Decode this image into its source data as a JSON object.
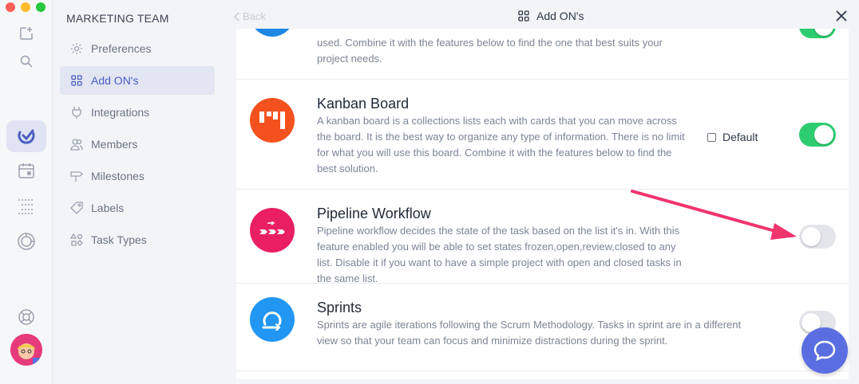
{
  "window": {
    "traffic_colors": [
      "#fe5f57",
      "#febc2e",
      "#28c840"
    ]
  },
  "rail": {
    "icons": [
      "new-task-icon",
      "search-icon",
      "app-logo-icon",
      "calendar-icon",
      "list-icon",
      "reports-icon",
      "help-icon"
    ]
  },
  "nav": {
    "team": "MARKETING TEAM",
    "items": [
      {
        "label": "Preferences",
        "icon": "gear-icon",
        "active": false
      },
      {
        "label": "Add ON's",
        "icon": "grid-icon",
        "active": true
      },
      {
        "label": "Integrations",
        "icon": "plug-icon",
        "active": false
      },
      {
        "label": "Members",
        "icon": "members-icon",
        "active": false
      },
      {
        "label": "Milestones",
        "icon": "signpost-icon",
        "active": false
      },
      {
        "label": "Labels",
        "icon": "tag-icon",
        "active": false
      },
      {
        "label": "Task Types",
        "icon": "shapes-icon",
        "active": false
      }
    ]
  },
  "header": {
    "back": "Back",
    "title": "Add ON's"
  },
  "addons": [
    {
      "title": "",
      "desc": "used. Combine it with the features below to find the one that best suits your project needs.",
      "enabled": true,
      "color": "#1e88e5"
    },
    {
      "title": "Kanban Board",
      "desc": "A kanban board is a collections lists each with cards that you can move across the board. It is the best way to organize any type of information. There is no limit for what you will use this board. Combine it with the features below to find the best solution.",
      "enabled": true,
      "default_label": "Default",
      "color": "#f4511e"
    },
    {
      "title": "Pipeline Workflow",
      "desc": "Pipeline workflow decides the state of the task based on the list it's in. With this feature enabled you will be able to set states frozen,open,review,closed to any list. Disable it if you want to have a simple project with open and closed tasks in the same list.",
      "enabled": false,
      "color": "#e91e63"
    },
    {
      "title": "Sprints",
      "desc": "Sprints are agile iterations following the Scrum Methodology. Tasks in sprint are in a different view so that your team can focus and minimize distractions during the sprint.",
      "enabled": false,
      "color": "#2196f3"
    }
  ],
  "colors": {
    "accent": "#4a5fc1",
    "toggle_on": "#2ecc71",
    "annotation_arrow": "#f0346e",
    "chat_button": "#5b6ee1"
  }
}
